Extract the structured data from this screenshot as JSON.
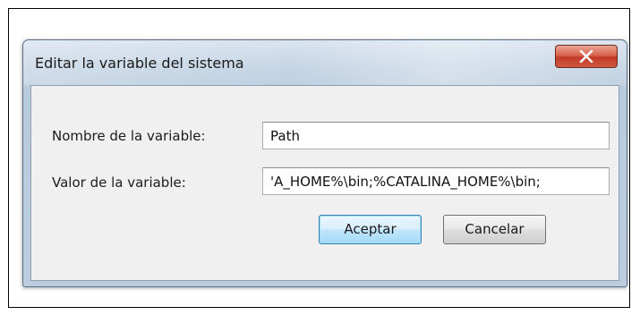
{
  "dialog": {
    "title": "Editar la variable del sistema",
    "close_glyph": "X",
    "fields": [
      {
        "label": "Nombre de la variable:",
        "value": "Path"
      },
      {
        "label": "Valor de la variable:",
        "value": "'A_HOME%\\bin;%CATALINA_HOME%\\bin;"
      }
    ],
    "buttons": {
      "ok": "Aceptar",
      "cancel": "Cancelar"
    }
  }
}
